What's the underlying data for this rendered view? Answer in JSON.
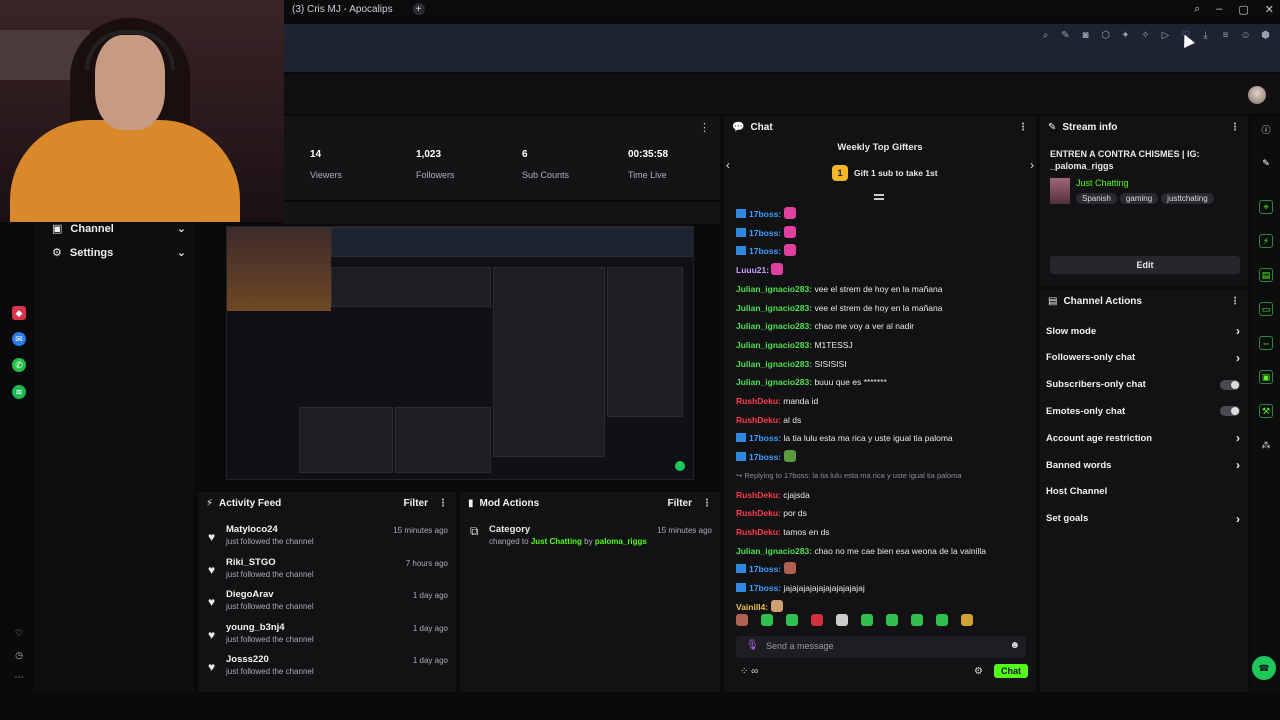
{
  "browser": {
    "tab_title": "(3) Cris MJ - Apocalips",
    "new_tab": "+"
  },
  "stats": {
    "viewers_value": "14",
    "viewers_label": "Viewers",
    "followers_value": "1,023",
    "followers_label": "Followers",
    "subs_value": "6",
    "subs_label": "Sub Counts",
    "time_value": "00:35:58",
    "time_label": "Time Live"
  },
  "sidebar": {
    "channel": "Channel",
    "settings": "Settings"
  },
  "activity": {
    "title": "Activity Feed",
    "filter": "Filter",
    "items": [
      {
        "name": "Matyloco24",
        "action": "just followed the channel",
        "time": "15 minutes ago"
      },
      {
        "name": "Riki_STGO",
        "action": "just followed the channel",
        "time": "7 hours ago"
      },
      {
        "name": "DiegoArav",
        "action": "just followed the channel",
        "time": "1 day ago"
      },
      {
        "name": "young_b3nj4",
        "action": "just followed the channel",
        "time": "1 day ago"
      },
      {
        "name": "Josss220",
        "action": "just followed the channel",
        "time": "1 day ago"
      }
    ]
  },
  "mod": {
    "title": "Mod Actions",
    "filter": "Filter",
    "item_title": "Category",
    "item_pre": "changed to",
    "item_category": "Just Chatting",
    "item_by": "by",
    "item_user": "paloma_riggs",
    "item_time": "15 minutes ago"
  },
  "chat": {
    "title": "Chat",
    "gifters_title": "Weekly Top Gifters",
    "gift_rank": "1",
    "gift_cta": "Gift 1 sub to take 1st",
    "placeholder": "Send a message",
    "send": "Chat",
    "lines": [
      {
        "user": "17boss:",
        "text": "",
        "color": "#3aa0ff",
        "badge": true,
        "emote": "#e040a0"
      },
      {
        "user": "17boss:",
        "text": "",
        "color": "#3aa0ff",
        "badge": true,
        "emote": "#e040a0"
      },
      {
        "user": "17boss:",
        "text": "",
        "color": "#3aa0ff",
        "badge": true,
        "emote": "#e040a0"
      },
      {
        "user": "Luuu21:",
        "text": "",
        "color": "#c89cff",
        "badge": false,
        "emote": "#e040a0"
      },
      {
        "user": "Julian_ignacio283:",
        "text": "vee el strem de hoy en la mañana",
        "color": "#4fe04f",
        "badge": false
      },
      {
        "user": "Julian_ignacio283:",
        "text": "vee el strem de hoy en la mañana",
        "color": "#4fe04f",
        "badge": false
      },
      {
        "user": "Julian_ignacio283:",
        "text": "chao me voy a ver al nadir",
        "color": "#4fe04f",
        "badge": false
      },
      {
        "user": "Julian_ignacio283:",
        "text": "M1TESSJ",
        "color": "#4fe04f",
        "badge": false
      },
      {
        "user": "Julian_ignacio283:",
        "text": "SISISISI",
        "color": "#4fe04f",
        "badge": false
      },
      {
        "user": "Julian_ignacio283:",
        "text": "buuu que es *******",
        "color": "#4fe04f",
        "badge": false
      },
      {
        "user": "RushDeku:",
        "text": "manda id",
        "color": "#ff3b4d",
        "badge": false
      },
      {
        "user": "RushDeku:",
        "text": "al ds",
        "color": "#ff3b4d",
        "badge": false
      },
      {
        "user": "17boss:",
        "text": "la tia lulu esta ma rica y uste igual tia paloma",
        "color": "#3aa0ff",
        "badge": true
      },
      {
        "user": "17boss:",
        "text": "",
        "color": "#3aa0ff",
        "badge": true,
        "emote": "#5a9a40"
      },
      {
        "user": "",
        "text": "↪ Replying to 17boss: la tia lulu esta ma rica y uste igual tia paloma",
        "color": "#888",
        "badge": false,
        "reply": true
      },
      {
        "user": "RushDeku:",
        "text": "cjajsda",
        "color": "#ff3b4d",
        "badge": false
      },
      {
        "user": "RushDeku:",
        "text": "por ds",
        "color": "#ff3b4d",
        "badge": false
      },
      {
        "user": "RushDeku:",
        "text": "tamos en ds",
        "color": "#ff3b4d",
        "badge": false
      },
      {
        "user": "Julian_ignacio283:",
        "text": "chao no me cae bien esa weona de la vainilla",
        "color": "#4fe04f",
        "badge": false
      },
      {
        "user": "17boss:",
        "text": "",
        "color": "#3aa0ff",
        "badge": true,
        "emote": "#b06050"
      },
      {
        "user": "17boss:",
        "text": "jajajajajajajajajajajajaj",
        "color": "#3aa0ff",
        "badge": true
      },
      {
        "user": "Vainill4:",
        "text": "",
        "color": "#e8c24a",
        "badge": false,
        "emote": "#d0a070"
      }
    ]
  },
  "stream_info": {
    "title": "Stream info",
    "stream_title": "ENTREN A CONTRA CHISMES | IG: _paloma_riggs",
    "category": "Just Chatting",
    "tags": [
      "Spanish",
      "gaming",
      "justtchating"
    ],
    "edit": "Edit"
  },
  "channel_actions": {
    "title": "Channel Actions",
    "items": [
      {
        "label": "Slow mode",
        "kind": "chevron"
      },
      {
        "label": "Followers-only chat",
        "kind": "chevron"
      },
      {
        "label": "Subscribers-only chat",
        "kind": "toggle"
      },
      {
        "label": "Emotes-only chat",
        "kind": "toggle"
      },
      {
        "label": "Account age restriction",
        "kind": "chevron"
      },
      {
        "label": "Banned words",
        "kind": "chevron"
      },
      {
        "label": "Host Channel",
        "kind": "none"
      },
      {
        "label": "Set goals",
        "kind": "chevron"
      }
    ]
  },
  "colors": {
    "accent_green": "#53fc18",
    "link_green": "#4fe04f"
  }
}
